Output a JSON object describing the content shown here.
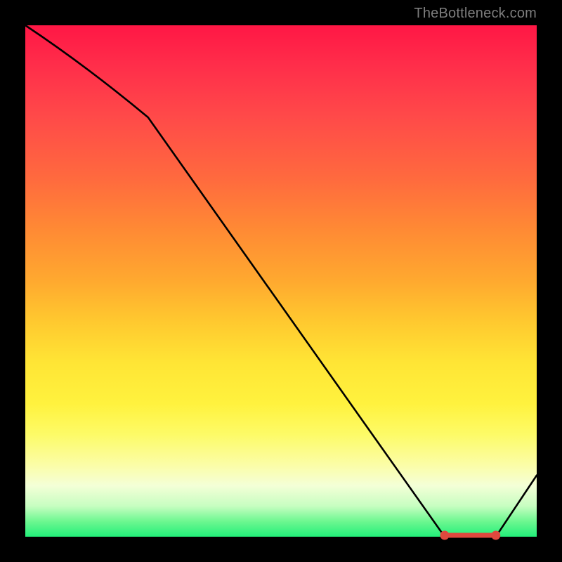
{
  "attribution": "TheBottleneck.com",
  "chart_data": {
    "type": "line",
    "title": "",
    "xlabel": "",
    "ylabel": "",
    "xlim": [
      0,
      100
    ],
    "ylim": [
      0,
      100
    ],
    "x": [
      0,
      24,
      82,
      92,
      100
    ],
    "values": [
      100,
      82,
      0,
      0,
      12
    ],
    "marker_segment": {
      "x_start": 82,
      "x_end": 92,
      "y": 0
    },
    "note": "x/y in percent of plot area; values estimated from pixels"
  }
}
